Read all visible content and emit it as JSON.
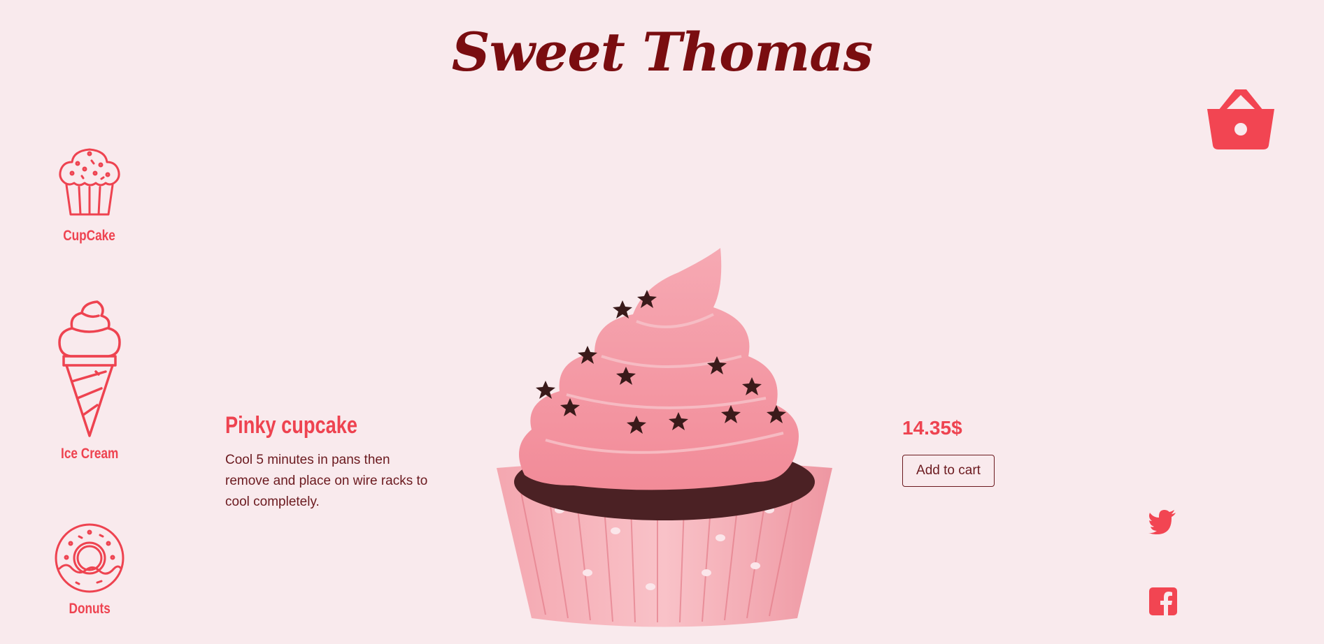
{
  "brand": {
    "title": "Sweet Thomas"
  },
  "header": {
    "cart_icon": "basket-icon"
  },
  "categories": [
    {
      "label": "CupCake",
      "icon": "cupcake-icon"
    },
    {
      "label": "Ice Cream",
      "icon": "ice-cream-cone-icon"
    },
    {
      "label": "Donuts",
      "icon": "donut-icon"
    }
  ],
  "product": {
    "name": "Pinky cupcake",
    "description": "Cool 5 minutes in pans then remove and place on wire racks to cool completely.",
    "price": "14.35$",
    "add_to_cart_label": "Add to cart",
    "image_icon": "pink-cupcake-image"
  },
  "social": {
    "twitter_icon": "twitter-icon",
    "facebook_icon": "facebook-icon"
  },
  "colors": {
    "background": "#f9eaed",
    "accent": "#ee4350",
    "brand": "#7a0d10",
    "text": "#6b1a1f"
  }
}
